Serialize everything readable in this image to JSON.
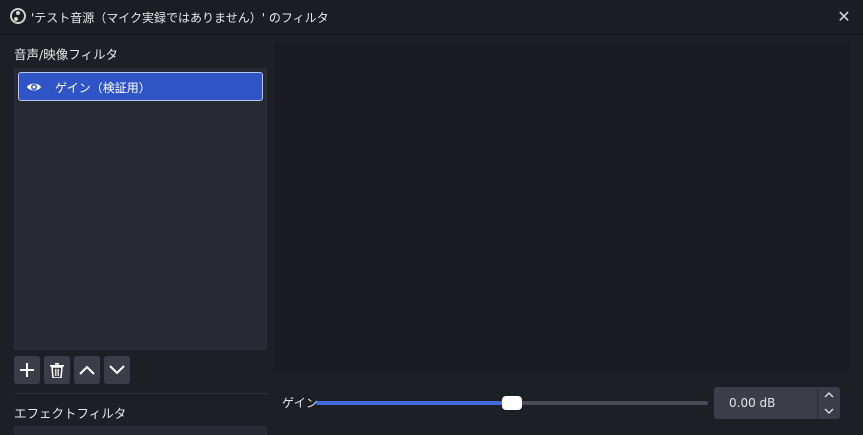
{
  "window": {
    "title": "'テスト音源（マイク実録ではありません）' のフィルタ",
    "close_glyph": "✕"
  },
  "left_panel": {
    "av_filters_label": "音声/映像フィルタ",
    "filters": [
      {
        "label": "ゲイン（検証用）",
        "visible": true,
        "selected": true
      }
    ],
    "effect_filters_label": "エフェクトフィルタ"
  },
  "toolbar": {
    "buttons": [
      {
        "name": "add-filter-button",
        "icon": "plus-icon"
      },
      {
        "name": "remove-filter-button",
        "icon": "trash-icon"
      },
      {
        "name": "move-up-button",
        "icon": "chevron-up-icon"
      },
      {
        "name": "move-down-button",
        "icon": "chevron-down-icon"
      }
    ]
  },
  "properties": {
    "gain_label": "ゲイン",
    "gain_value": "0.00 dB",
    "gain_slider_level": 0.5
  },
  "colors": {
    "accent": "#2f54c6",
    "slider_fill": "#3f6bdc",
    "background": "#1d1f26"
  }
}
